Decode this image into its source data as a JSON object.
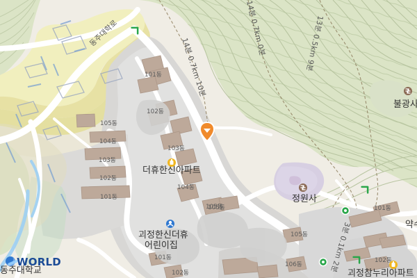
{
  "map": {
    "logo_text": "WORLD",
    "road_labels": [
      "동주대학로"
    ],
    "trail_labels": [
      "14분 0.7km 10분",
      "14분 0.7km 0분",
      "13분 0.5km 9분",
      "3분 0.1km 2분"
    ],
    "buildings": [
      "101동",
      "102동",
      "103동",
      "104동",
      "105동",
      "105동",
      "104동",
      "103동",
      "102동",
      "101동",
      "105동",
      "106동",
      "101동",
      "102동",
      "101동",
      "102동",
      "105동"
    ],
    "pois": {
      "apartment": "더휴한신아파트",
      "daycare_top": "괴정한신더휴",
      "daycare_bottom": "어린이집",
      "temple": "정원사",
      "temple_right": "불광사",
      "bottom_right": "괴정참누리아파트",
      "pharmacy": "약수",
      "university": "동주대학교"
    },
    "colors": {
      "forest": "#dbe4c6",
      "forest_dark": "#cbd7b4",
      "road": "#ffffff",
      "campus": "#f2efbf",
      "residential": "#d8d8d8",
      "building": "#bda99a",
      "temple": "#d7cfe2",
      "water": "#9fd0f1",
      "accent": "#f08a2b"
    }
  }
}
